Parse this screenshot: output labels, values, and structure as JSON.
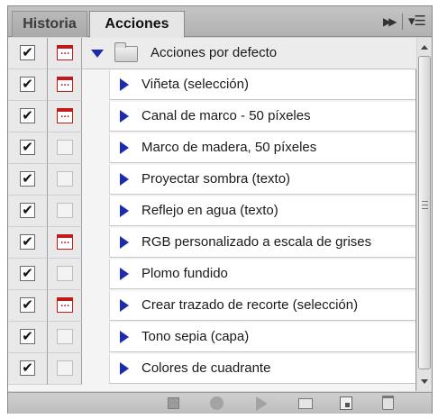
{
  "tabs": [
    {
      "label": "Historia",
      "active": false
    },
    {
      "label": "Acciones",
      "active": true
    }
  ],
  "panel_controls": [
    "fast-forward-icon",
    "panel-menu-icon"
  ],
  "action_set": {
    "name": "Acciones por defecto",
    "checked": true,
    "dialog": true,
    "expanded": true
  },
  "actions": [
    {
      "label": "Viñeta (selección)",
      "checked": true,
      "dialog": true
    },
    {
      "label": "Canal de marco - 50 píxeles",
      "checked": true,
      "dialog": true
    },
    {
      "label": "Marco de madera, 50 píxeles",
      "checked": true,
      "dialog": false
    },
    {
      "label": "Proyectar sombra (texto)",
      "checked": true,
      "dialog": false
    },
    {
      "label": "Reflejo en agua (texto)",
      "checked": true,
      "dialog": false
    },
    {
      "label": "RGB personalizado a escala de grises",
      "checked": true,
      "dialog": true
    },
    {
      "label": "Plomo fundido",
      "checked": true,
      "dialog": false
    },
    {
      "label": "Crear trazado de recorte (selección)",
      "checked": true,
      "dialog": true
    },
    {
      "label": "Tono sepia (capa)",
      "checked": true,
      "dialog": false
    },
    {
      "label": "Colores de cuadrante",
      "checked": true,
      "dialog": false
    }
  ],
  "toolbar_icons": [
    "stop-icon",
    "record-icon",
    "play-icon",
    "new-set-icon",
    "new-action-icon",
    "trash-icon"
  ],
  "colors": {
    "dialog_red": "#c21a1a",
    "triangle_blue": "#1d2bb0"
  }
}
